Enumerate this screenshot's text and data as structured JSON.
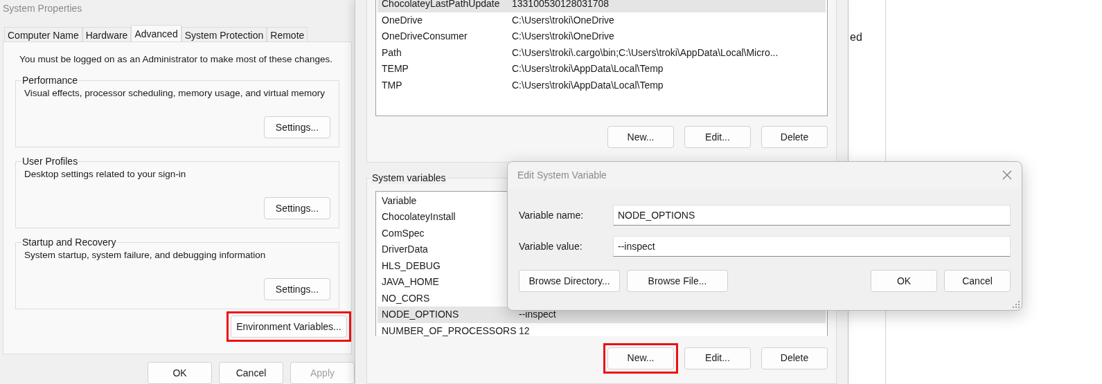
{
  "background_window": {
    "text_fragment": "ed"
  },
  "system_properties": {
    "title": "System Properties",
    "tabs": [
      {
        "label": "Computer Name",
        "selected": false
      },
      {
        "label": "Hardware",
        "selected": false
      },
      {
        "label": "Advanced",
        "selected": true
      },
      {
        "label": "System Protection",
        "selected": false
      },
      {
        "label": "Remote",
        "selected": false
      }
    ],
    "notice": "You must be logged on as an Administrator to make most of these changes.",
    "groups": [
      {
        "title": "Performance",
        "description": "Visual effects, processor scheduling, memory usage, and virtual memory",
        "button": "Settings..."
      },
      {
        "title": "User Profiles",
        "description": "Desktop settings related to your sign-in",
        "button": "Settings..."
      },
      {
        "title": "Startup and Recovery",
        "description": "System startup, system failure, and debugging information",
        "button": "Settings..."
      }
    ],
    "environment_button": {
      "label": "Environment Variables...",
      "highlighted": true
    },
    "buttons": [
      {
        "label": "OK",
        "disabled": false
      },
      {
        "label": "Cancel",
        "disabled": false
      },
      {
        "label": "Apply",
        "disabled": true
      }
    ]
  },
  "environment_variables": {
    "user_rows": [
      {
        "name": "ChocolateyLastPathUpdate",
        "value": "133100530128031708",
        "selected": true
      },
      {
        "name": "OneDrive",
        "value": "C:\\Users\\troki\\OneDrive",
        "selected": false
      },
      {
        "name": "OneDriveConsumer",
        "value": "C:\\Users\\troki\\OneDrive",
        "selected": false
      },
      {
        "name": "Path",
        "value": "C:\\Users\\troki\\.cargo\\bin;C:\\Users\\troki\\AppData\\Local\\Micro...",
        "selected": false
      },
      {
        "name": "TEMP",
        "value": "C:\\Users\\troki\\AppData\\Local\\Temp",
        "selected": false
      },
      {
        "name": "TMP",
        "value": "C:\\Users\\troki\\AppData\\Local\\Temp",
        "selected": false
      }
    ],
    "user_buttons": [
      {
        "label": "New...",
        "highlighted": false
      },
      {
        "label": "Edit...",
        "highlighted": false
      },
      {
        "label": "Delete",
        "highlighted": false
      }
    ],
    "system_group": "System variables",
    "system_columns": [
      "Variable"
    ],
    "system_rows": [
      {
        "name": "ChocolateyInstall",
        "selected": false
      },
      {
        "name": "ComSpec",
        "selected": false
      },
      {
        "name": "DriverData",
        "selected": false
      },
      {
        "name": "HLS_DEBUG",
        "selected": false
      },
      {
        "name": "JAVA_HOME",
        "selected": false
      },
      {
        "name": "NO_CORS",
        "selected": false
      },
      {
        "name": "NODE_OPTIONS",
        "value": "--inspect",
        "selected": true
      },
      {
        "name": "NUMBER_OF_PROCESSORS",
        "value": "12",
        "selected": false
      }
    ],
    "system_buttons": [
      {
        "label": "New...",
        "highlighted": true
      },
      {
        "label": "Edit...",
        "highlighted": false
      },
      {
        "label": "Delete",
        "highlighted": false
      }
    ]
  },
  "edit_dialog": {
    "title": "Edit System Variable",
    "fields": [
      {
        "label": "Variable name:",
        "value": "NODE_OPTIONS"
      },
      {
        "label": "Variable value:",
        "value": "--inspect"
      }
    ],
    "left_buttons": [
      "Browse Directory...",
      "Browse File..."
    ],
    "right_buttons": [
      "OK",
      "Cancel"
    ]
  }
}
